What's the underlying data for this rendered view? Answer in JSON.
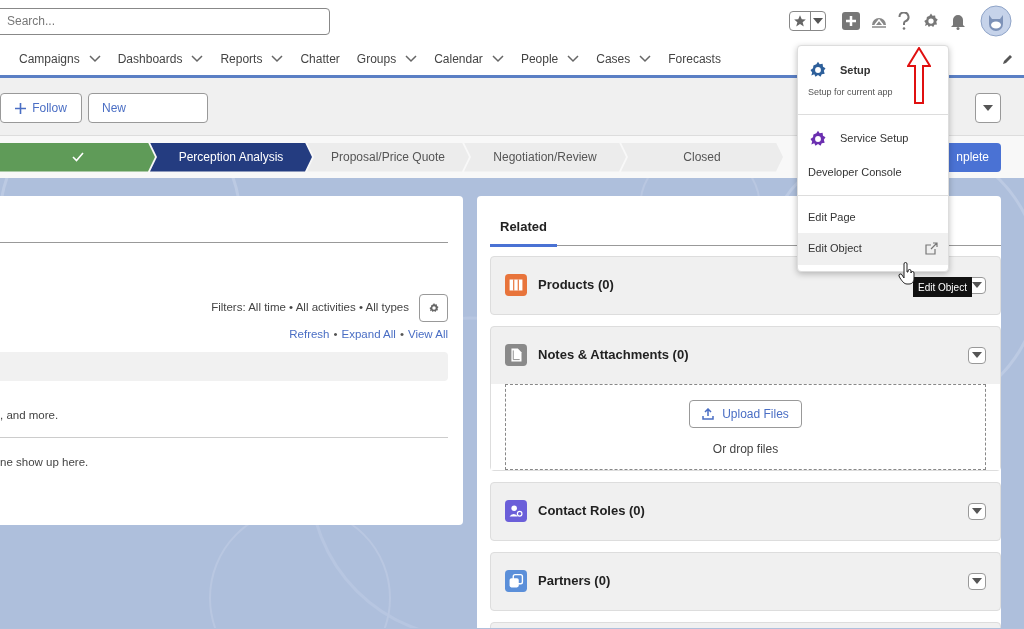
{
  "header": {
    "search": {
      "placeholder": "Search..."
    }
  },
  "nav": {
    "items": [
      {
        "label": "Campaigns",
        "has_menu": true
      },
      {
        "label": "Dashboards",
        "has_menu": true
      },
      {
        "label": "Reports",
        "has_menu": true
      },
      {
        "label": "Chatter",
        "has_menu": false
      },
      {
        "label": "Groups",
        "has_menu": true
      },
      {
        "label": "Calendar",
        "has_menu": true
      },
      {
        "label": "People",
        "has_menu": true
      },
      {
        "label": "Cases",
        "has_menu": true
      },
      {
        "label": "Forecasts",
        "has_menu": false
      }
    ]
  },
  "actions": [
    {
      "label": "Follow",
      "kind": "follow"
    },
    {
      "label": "New",
      "kind": "plain"
    }
  ],
  "path": {
    "steps": [
      {
        "completed": true,
        "selected": false
      },
      {
        "label": "Perception Analysis",
        "completed": false,
        "selected": true
      },
      {
        "label": "Proposal/Price Quote",
        "completed": false,
        "selected": false
      },
      {
        "label": "Negotiation/Review",
        "completed": false,
        "selected": false
      },
      {
        "label": "Closed",
        "completed": false,
        "selected": false
      }
    ],
    "complete_button": "nplete"
  },
  "activity": {
    "filters": "Filters: All time • All activities • All types",
    "links": [
      "Refresh",
      "Expand All",
      "View All"
    ],
    "link_separator": "•",
    "text_1": ", and more.",
    "text_2": "ne show up here."
  },
  "related": {
    "tab": "Related",
    "sections": [
      {
        "title": "Products (0)",
        "color": "#e8743b",
        "kind": "grid"
      },
      {
        "title": "Notes & Attachments (0)",
        "color": "#8a8a8a",
        "kind": "files",
        "upload": "Upload Files",
        "drop": "Or drop files"
      },
      {
        "title": "Contact Roles (0)",
        "color": "#6b5fd9",
        "kind": "person"
      },
      {
        "title": "Partners (0)",
        "color": "#5b8fd9",
        "kind": "stack"
      }
    ]
  },
  "setup_menu": {
    "items": [
      {
        "label": "Setup",
        "subtitle": "Setup for current app",
        "kind": "app",
        "color": "#2d5f9a",
        "group_start": false,
        "hovered": false
      },
      {
        "label": "Service Setup",
        "kind": "app",
        "color": "#6b2fb0",
        "group_start": true,
        "hovered": false
      },
      {
        "label": "Developer Console",
        "kind": "plain",
        "group_start": false,
        "hovered": false
      },
      {
        "label": "Edit Page",
        "kind": "plain",
        "group_start": true,
        "hovered": false
      },
      {
        "label": "Edit Object",
        "kind": "external",
        "group_start": false,
        "hovered": true
      }
    ],
    "tooltip": "Edit Object"
  }
}
